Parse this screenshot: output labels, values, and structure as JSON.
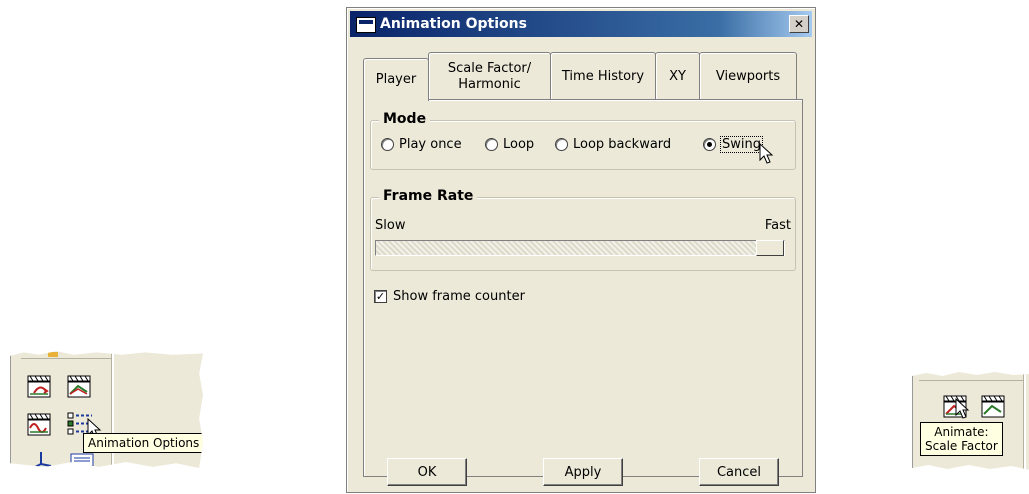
{
  "dialog": {
    "title": "Animation Options",
    "close_glyph": "✕",
    "tabs": [
      {
        "label": "Player",
        "active": true
      },
      {
        "label": "Scale Factor/ Harmonic",
        "active": false
      },
      {
        "label": "Time History",
        "active": false
      },
      {
        "label": "XY",
        "active": false
      },
      {
        "label": "Viewports",
        "active": false
      }
    ],
    "mode": {
      "title": "Mode",
      "options": [
        "Play once",
        "Loop",
        "Loop backward",
        "Swing"
      ],
      "selected": "Swing"
    },
    "frame_rate": {
      "title": "Frame Rate",
      "min_label": "Slow",
      "max_label": "Fast",
      "value_fraction": 1.0
    },
    "show_frame_counter": {
      "label": "Show frame counter",
      "checked": true
    },
    "buttons": {
      "ok": "OK",
      "apply": "Apply",
      "cancel": "Cancel"
    }
  },
  "left_toolbar": {
    "tooltip": "Animation Options",
    "icons": [
      "animate-time-icon",
      "animate-scale-icon",
      "animate-harmonic-icon",
      "animation-options-icon"
    ]
  },
  "right_toolbar": {
    "tooltip_line1": "Animate:",
    "tooltip_line2": "Scale Factor",
    "icons": [
      "animate-time-icon",
      "animate-scale-icon"
    ]
  },
  "colors": {
    "dialog_bg": "#ece9d8",
    "title_start": "#0a246a",
    "title_end": "#a6caf0",
    "tooltip_bg": "#ffffe1"
  }
}
